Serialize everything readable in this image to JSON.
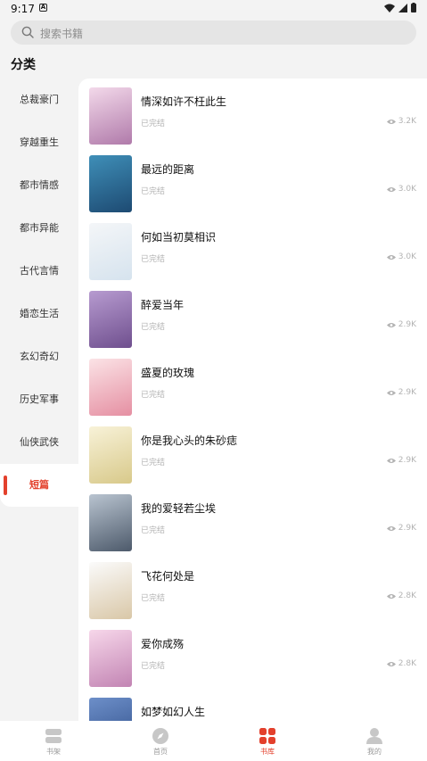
{
  "status_bar": {
    "time": "9:17",
    "notification_glyph": "A"
  },
  "search": {
    "placeholder": "搜索书籍"
  },
  "page_title": "分类",
  "sidebar": {
    "items": [
      {
        "label": "总裁豪门",
        "active": false
      },
      {
        "label": "穿越重生",
        "active": false
      },
      {
        "label": "都市情感",
        "active": false
      },
      {
        "label": "都市异能",
        "active": false
      },
      {
        "label": "古代言情",
        "active": false
      },
      {
        "label": "婚恋生活",
        "active": false
      },
      {
        "label": "玄幻奇幻",
        "active": false
      },
      {
        "label": "历史军事",
        "active": false
      },
      {
        "label": "仙侠武侠",
        "active": false
      },
      {
        "label": "短篇",
        "active": true
      }
    ]
  },
  "books": [
    {
      "title": "情深如许不枉此生",
      "status": "已完结",
      "views": "3.2K",
      "cover_colors": [
        "#f3d9ea",
        "#b07aaa"
      ]
    },
    {
      "title": "最远的距离",
      "status": "已完结",
      "views": "3.0K",
      "cover_colors": [
        "#3f8fb8",
        "#1d4a72"
      ]
    },
    {
      "title": "何如当初莫相识",
      "status": "已完结",
      "views": "3.0K",
      "cover_colors": [
        "#f4f6f8",
        "#d6e3ee"
      ]
    },
    {
      "title": "醉爱当年",
      "status": "已完结",
      "views": "2.9K",
      "cover_colors": [
        "#b79bd0",
        "#6f4f8e"
      ]
    },
    {
      "title": "盛夏的玫瑰",
      "status": "已完结",
      "views": "2.9K",
      "cover_colors": [
        "#fbe3e6",
        "#e58fa2"
      ]
    },
    {
      "title": "你是我心头的朱砂痣",
      "status": "已完结",
      "views": "2.9K",
      "cover_colors": [
        "#f8f2d8",
        "#d8c98a"
      ]
    },
    {
      "title": "我的爱轻若尘埃",
      "status": "已完结",
      "views": "2.9K",
      "cover_colors": [
        "#b9c4d0",
        "#4d5a6b"
      ]
    },
    {
      "title": "飞花何处是",
      "status": "已完结",
      "views": "2.8K",
      "cover_colors": [
        "#fbfbfb",
        "#d9c7a7"
      ]
    },
    {
      "title": "爱你成殇",
      "status": "已完结",
      "views": "2.8K",
      "cover_colors": [
        "#f7d7ea",
        "#c284b3"
      ]
    },
    {
      "title": "如梦如幻人生",
      "status": "",
      "views": "",
      "cover_colors": [
        "#6d8fc9",
        "#2d4c86"
      ]
    }
  ],
  "tabbar": {
    "tabs": [
      {
        "label": "书架",
        "icon": "bookshelf-icon",
        "active": false
      },
      {
        "label": "首页",
        "icon": "compass-icon",
        "active": false
      },
      {
        "label": "书库",
        "icon": "grid-icon",
        "active": true
      },
      {
        "label": "我的",
        "icon": "user-icon",
        "active": false
      }
    ]
  },
  "colors": {
    "accent": "#e3402c",
    "inactive_icon": "#c7c7c7"
  }
}
